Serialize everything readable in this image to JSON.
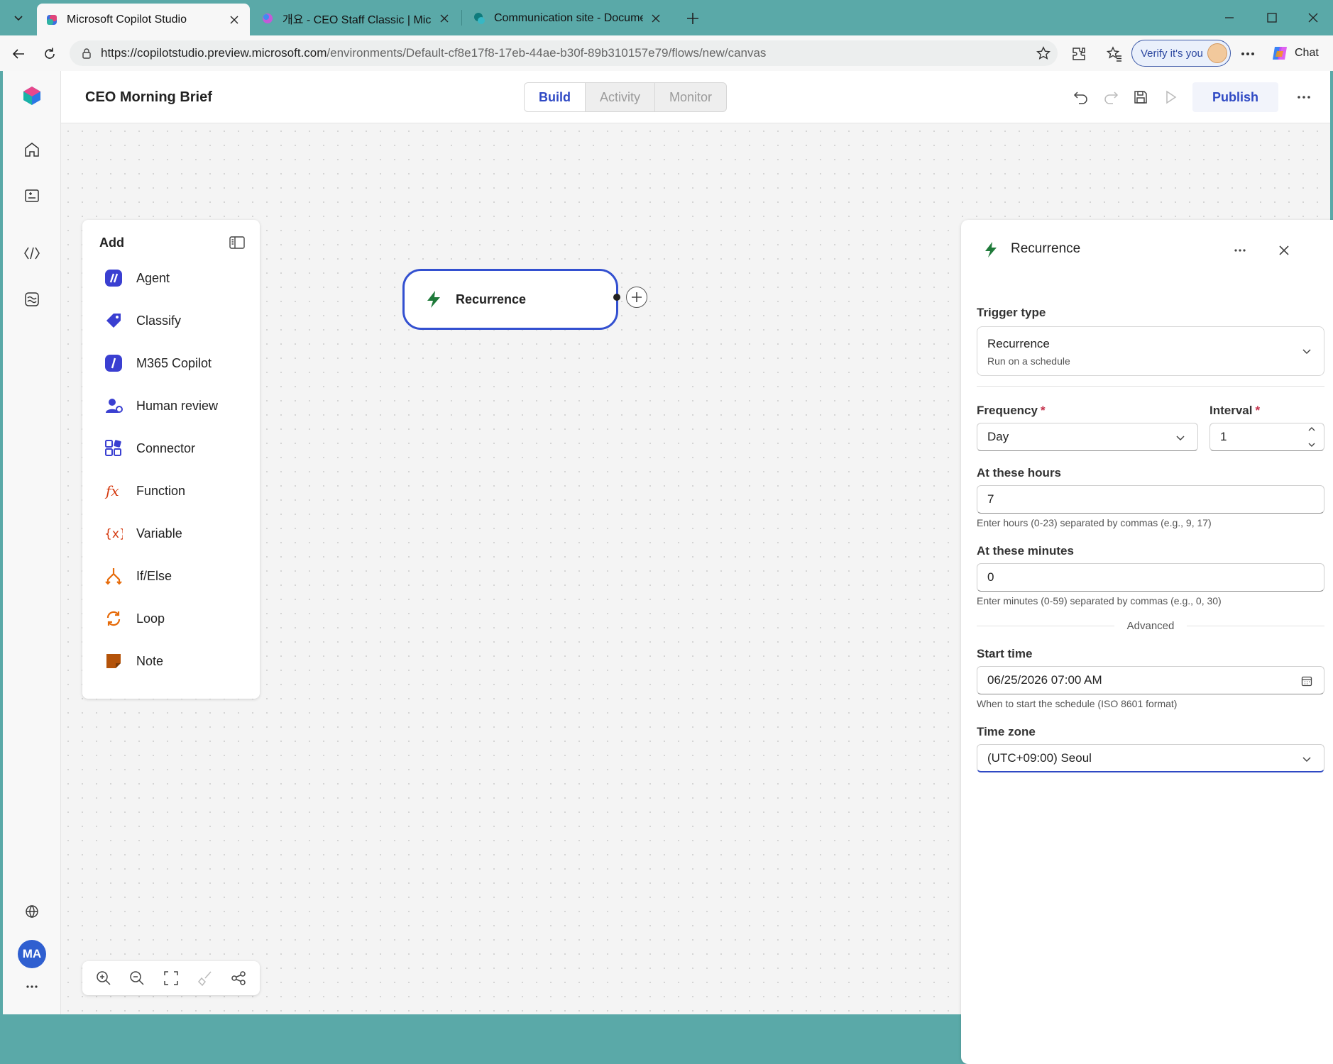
{
  "browser": {
    "tabs": [
      {
        "title": "Microsoft Copilot Studio",
        "active": true
      },
      {
        "title": "개요 - CEO Staff Classic | Microsoft",
        "active": false
      },
      {
        "title": "Communication site - Documents",
        "active": false
      }
    ],
    "url_host": "https://copilotstudio.preview.microsoft.com",
    "url_path": "/environments/Default-cf8e17f8-17eb-44ae-b30f-89b310157e79/flows/new/canvas",
    "verify_label": "Verify it's you",
    "chat_label": "Chat"
  },
  "header": {
    "flow_title": "CEO Morning Brief",
    "tabs": [
      "Build",
      "Activity",
      "Monitor"
    ],
    "active_tab": "Build",
    "publish_label": "Publish"
  },
  "rail": {
    "avatar_initials": "MA"
  },
  "add_panel": {
    "title": "Add",
    "items": [
      {
        "label": "Agent",
        "icon": "agent-icon"
      },
      {
        "label": "Classify",
        "icon": "tag-icon"
      },
      {
        "label": "M365 Copilot",
        "icon": "copilot-icon"
      },
      {
        "label": "Human review",
        "icon": "person-icon"
      },
      {
        "label": "Connector",
        "icon": "connector-icon"
      },
      {
        "label": "Function",
        "icon": "function-icon"
      },
      {
        "label": "Variable",
        "icon": "variable-icon"
      },
      {
        "label": "If/Else",
        "icon": "branch-icon"
      },
      {
        "label": "Loop",
        "icon": "loop-icon"
      },
      {
        "label": "Note",
        "icon": "note-icon"
      }
    ]
  },
  "node": {
    "label": "Recurrence"
  },
  "props": {
    "title": "Recurrence",
    "trigger_type_label": "Trigger type",
    "trigger_type_value": "Recurrence",
    "trigger_type_desc": "Run on a schedule",
    "frequency_label": "Frequency",
    "frequency_value": "Day",
    "interval_label": "Interval",
    "interval_value": "1",
    "required_mark": "*",
    "hours_label": "At these hours",
    "hours_value": "7",
    "hours_hint": "Enter hours (0-23) separated by commas (e.g., 9, 17)",
    "minutes_label": "At these minutes",
    "minutes_value": "0",
    "minutes_hint": "Enter minutes (0-59) separated by commas (e.g., 0, 30)",
    "advanced_label": "Advanced",
    "start_label": "Start time",
    "start_value": "06/25/2026 07:00 AM",
    "start_hint": "When to start the schedule (ISO 8601 format)",
    "tz_label": "Time zone",
    "tz_value": "(UTC+09:00) Seoul"
  },
  "colors": {
    "accent": "#2f49c4",
    "titlebar": "#5aa9a8",
    "trigger_green": "#1f7a3a"
  }
}
